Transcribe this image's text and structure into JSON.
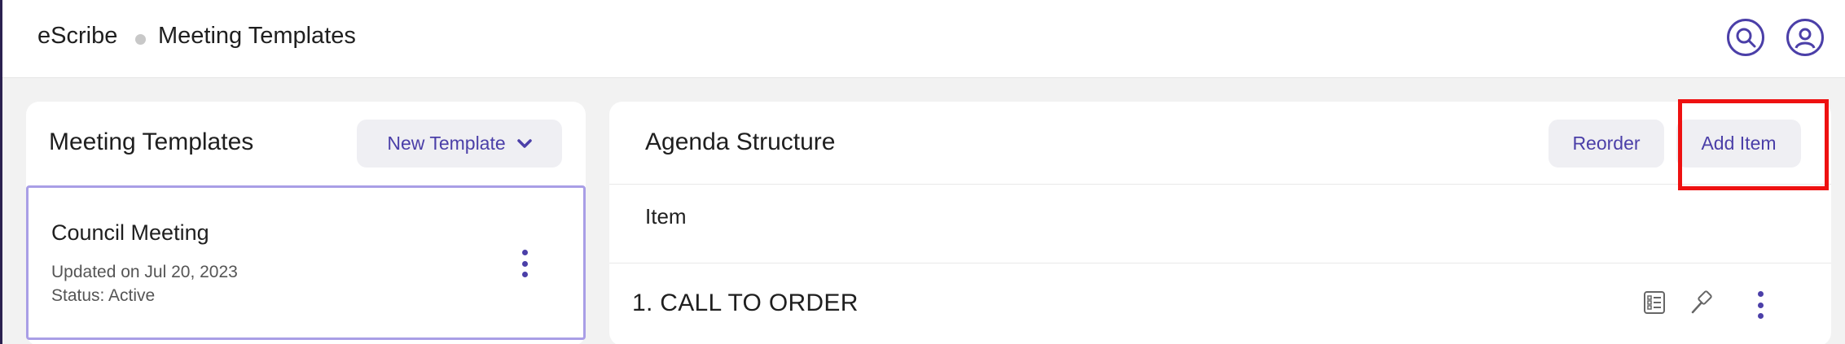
{
  "header": {
    "brand": "eScribe",
    "page_title": "Meeting Templates",
    "search_icon": "search-icon",
    "profile_icon": "user-profile-icon"
  },
  "left_panel": {
    "title": "Meeting Templates",
    "new_template_label": "New Template",
    "templates": [
      {
        "name": "Council Meeting",
        "updated": "Updated on Jul 20, 2023",
        "status": "Status: Active",
        "selected": true
      }
    ]
  },
  "right_panel": {
    "title": "Agenda Structure",
    "reorder_label": "Reorder",
    "add_item_label": "Add Item",
    "column_header": "Item",
    "items": [
      {
        "label": "1. CALL TO ORDER"
      }
    ]
  },
  "colors": {
    "accent": "#4b3fa8",
    "highlight": "#ee1111",
    "selected_border": "#a99ee6"
  }
}
